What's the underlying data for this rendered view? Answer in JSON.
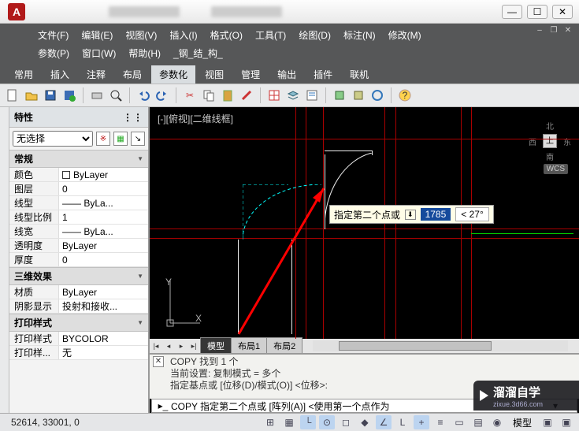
{
  "titlebar": {
    "win_min": "—",
    "win_max": "☐",
    "win_close": "✕"
  },
  "menus": {
    "row1": [
      "文件(F)",
      "编辑(E)",
      "视图(V)",
      "插入(I)",
      "格式(O)",
      "工具(T)",
      "绘图(D)",
      "标注(N)",
      "修改(M)"
    ],
    "row2": [
      "参数(P)",
      "窗口(W)",
      "帮助(H)",
      "_钢_结_构_"
    ]
  },
  "ribbon": {
    "tabs": [
      "常用",
      "插入",
      "注释",
      "布局",
      "参数化",
      "视图",
      "管理",
      "输出",
      "插件",
      "联机"
    ],
    "active_index": 4
  },
  "props": {
    "title": "特性",
    "selection": "无选择",
    "sections": [
      {
        "header": "常规",
        "rows": [
          {
            "k": "颜色",
            "v": "ByLayer",
            "swatch": true
          },
          {
            "k": "图层",
            "v": "0"
          },
          {
            "k": "线型",
            "v": "—— ByLa..."
          },
          {
            "k": "线型比例",
            "v": "1"
          },
          {
            "k": "线宽",
            "v": "—— ByLa..."
          },
          {
            "k": "透明度",
            "v": "ByLayer"
          },
          {
            "k": "厚度",
            "v": "0"
          }
        ]
      },
      {
        "header": "三维效果",
        "rows": [
          {
            "k": "材质",
            "v": "ByLayer"
          },
          {
            "k": "阴影显示",
            "v": "投射和接收..."
          }
        ]
      },
      {
        "header": "打印样式",
        "rows": [
          {
            "k": "打印样式",
            "v": "BYCOLOR"
          },
          {
            "k": "打印样...",
            "v": "无"
          }
        ]
      }
    ]
  },
  "viewport": {
    "label": "[-][俯视][二维线框]",
    "wcs": "WCS",
    "compass": {
      "n": "北",
      "s": "南",
      "e": "东",
      "w": "西",
      "cube": "上"
    },
    "prompt": "指定第二个点或",
    "distance": "1785",
    "angle": "< 27°",
    "ucs_x": "X",
    "ucs_y": "Y"
  },
  "model_tabs": {
    "tabs": [
      "模型",
      "布局1",
      "布局2"
    ],
    "active_index": 0
  },
  "cmd": {
    "line1": "COPY 找到 1 个",
    "line2": "当前设置:  复制模式 = 多个",
    "line3": "指定基点或 [位移(D)/模式(O)] <位移>:",
    "input_prefix": "COPY 指定第二个点或 [阵列(A)] <使用第一个点作为",
    "caret": "▾"
  },
  "status": {
    "coord": "52614, 33001, 0",
    "model": "模型"
  },
  "watermark": {
    "brand": "溜溜自学",
    "url": "zixue.3d66.com"
  }
}
